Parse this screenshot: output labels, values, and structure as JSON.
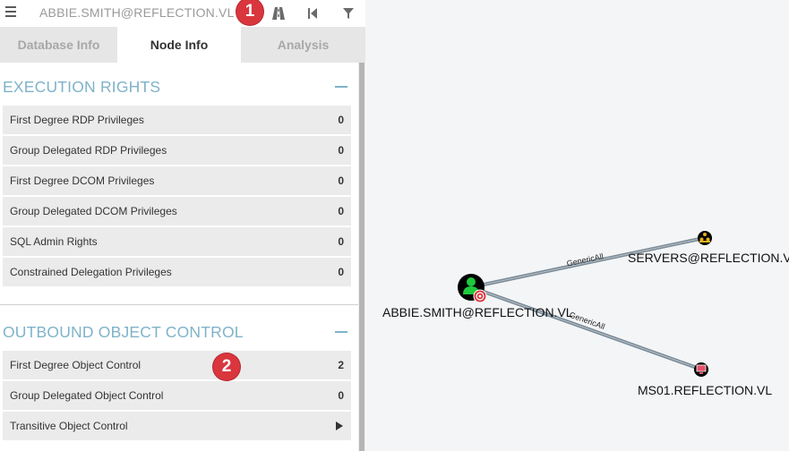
{
  "search": {
    "text": "ABBIE.SMITH@REFLECTION.VL"
  },
  "badges": {
    "one": "1",
    "two": "2"
  },
  "tabs": [
    {
      "label": "Database Info"
    },
    {
      "label": "Node Info"
    },
    {
      "label": "Analysis"
    }
  ],
  "execution_rights": {
    "title": "EXECUTION RIGHTS",
    "rows": [
      {
        "label": "First Degree RDP Privileges",
        "value": "0"
      },
      {
        "label": "Group Delegated RDP Privileges",
        "value": "0"
      },
      {
        "label": "First Degree DCOM Privileges",
        "value": "0"
      },
      {
        "label": "Group Delegated DCOM Privileges",
        "value": "0"
      },
      {
        "label": "SQL Admin Rights",
        "value": "0"
      },
      {
        "label": "Constrained Delegation Privileges",
        "value": "0"
      }
    ]
  },
  "outbound_control": {
    "title": "OUTBOUND OBJECT CONTROL",
    "rows": [
      {
        "label": "First Degree Object Control",
        "value": "2"
      },
      {
        "label": "Group Delegated Object Control",
        "value": "0"
      },
      {
        "label": "Transitive Object Control",
        "value": ""
      }
    ]
  },
  "graph": {
    "nodes": {
      "user": {
        "label": "ABBIE.SMITH@REFLECTION.VL",
        "icon": "user-icon"
      },
      "group": {
        "label": "SERVERS@REFLECTION.VL",
        "icon": "group-icon"
      },
      "computer": {
        "label": "MS01.REFLECTION.VL",
        "icon": "computer-icon"
      }
    },
    "edges": [
      {
        "label": "GenericAll"
      },
      {
        "label": "GenericAll"
      }
    ]
  },
  "colors": {
    "accent": "#7fb3c9",
    "badge": "#d9363e",
    "edge": "#7a8a96",
    "user_node": "#1ec93c",
    "group_node": "#e8b11c",
    "computer_node": "#e8506a"
  }
}
